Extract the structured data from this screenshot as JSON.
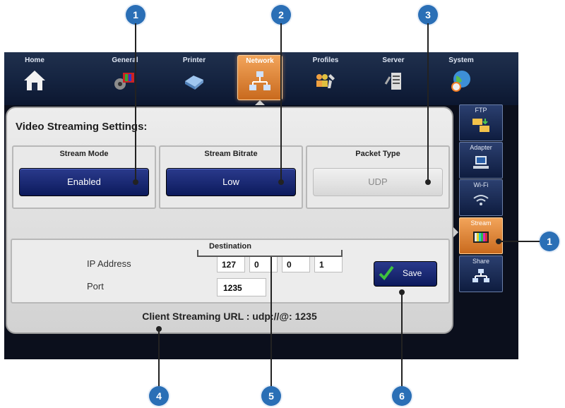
{
  "topnav": {
    "tabs": [
      {
        "label": "Home",
        "icon": "home-icon"
      },
      {
        "label": "General",
        "icon": "general-icon"
      },
      {
        "label": "Printer",
        "icon": "printer-icon"
      },
      {
        "label": "Network",
        "icon": "network-icon",
        "active": true
      },
      {
        "label": "Profiles",
        "icon": "profiles-icon"
      },
      {
        "label": "Server",
        "icon": "server-icon"
      },
      {
        "label": "System",
        "icon": "system-icon"
      }
    ]
  },
  "panel": {
    "title": "Video Streaming Settings:",
    "stream_mode": {
      "label": "Stream Mode",
      "value": "Enabled"
    },
    "stream_bitrate": {
      "label": "Stream Bitrate",
      "value": "Low"
    },
    "packet_type": {
      "label": "Packet Type",
      "value": "UDP"
    },
    "destination": {
      "title": "Destination",
      "ip_label": "IP Address",
      "ip": [
        "127",
        "0",
        "0",
        "1"
      ],
      "port_label": "Port",
      "port": "1235",
      "save_label": "Save"
    },
    "url": "Client Streaming URL : udp://@: 1235"
  },
  "sidebar": {
    "items": [
      {
        "label": "FTP",
        "icon": "ftp-icon"
      },
      {
        "label": "Adapter",
        "icon": "adapter-icon"
      },
      {
        "label": "Wi-Fi",
        "icon": "wifi-icon"
      },
      {
        "label": "Stream",
        "icon": "stream-icon",
        "active": true
      },
      {
        "label": "Share",
        "icon": "share-icon"
      }
    ]
  },
  "callouts": [
    "1",
    "2",
    "3",
    "1",
    "4",
    "5",
    "6"
  ],
  "colors": {
    "accent": "#e58a37",
    "marker": "#2a6fb6",
    "nav": "#152441"
  }
}
